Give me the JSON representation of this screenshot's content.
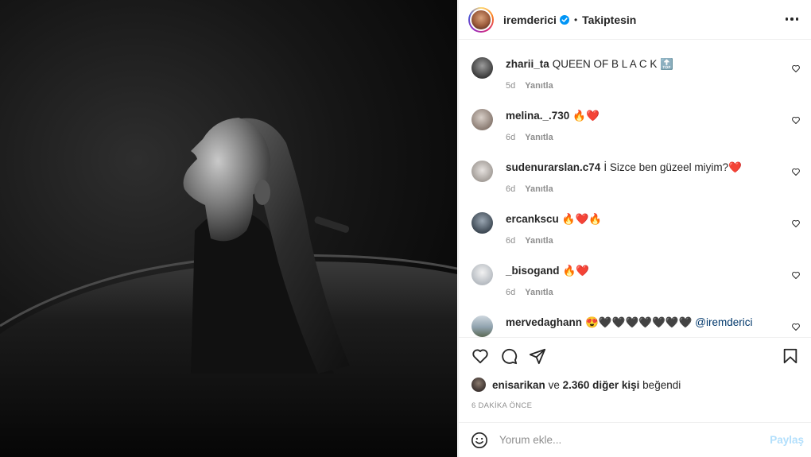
{
  "post": {
    "author": "iremderici",
    "follow_status": "Takiptesin",
    "separator": "•"
  },
  "comments": [
    {
      "user": "zharii_ta",
      "text": "QUEEN OF B L A C K 🔝",
      "age": "5d",
      "reply": "Yanıtla"
    },
    {
      "user": "melina._.730",
      "text": "🔥❤️",
      "age": "6d",
      "reply": "Yanıtla"
    },
    {
      "user": "sudenurarslan.c74",
      "text": "İ Sizce ben güzeel miyim?❤️",
      "age": "6d",
      "reply": "Yanıtla"
    },
    {
      "user": "ercankscu",
      "text": "🔥❤️🔥",
      "age": "6d",
      "reply": "Yanıtla"
    },
    {
      "user": "_bisogand",
      "text": "🔥❤️",
      "age": "6d",
      "reply": "Yanıtla"
    },
    {
      "user": "mervedaghann",
      "text": "😍🖤🖤🖤🖤🖤🖤🖤",
      "mention": "@iremderici",
      "age": "",
      "reply": ""
    }
  ],
  "likes": {
    "user": "enisarikan",
    "connector": "ve",
    "others": "2.360 diğer kişi",
    "suffix": "beğendi"
  },
  "time": "6 DAKİKA ÖNCE",
  "add_comment": {
    "placeholder": "Yorum ekle...",
    "share_label": "Paylaş"
  },
  "icons": {
    "more": "more-options-icon",
    "like": "heart-icon",
    "comment": "comment-icon",
    "share": "paper-plane-icon",
    "save": "bookmark-icon",
    "emoji": "emoji-icon",
    "verified": "verified-badge-icon"
  },
  "colors": {
    "verified": "#0095f6",
    "share_disabled": "#b2dffc",
    "meta": "#8e8e8e"
  }
}
